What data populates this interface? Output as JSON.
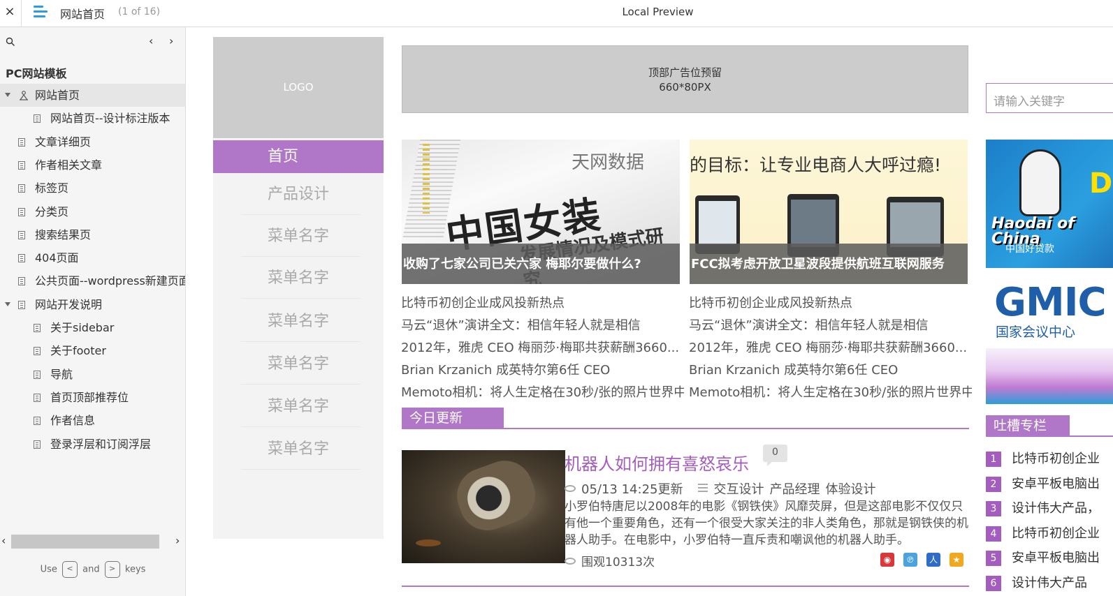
{
  "topbar": {
    "close": "×",
    "page_name": "网站首页",
    "page_count": "(1 of 16)",
    "title": "Local Preview"
  },
  "sidebar": {
    "prev": "‹",
    "next": "›",
    "project": "PC网站模板",
    "items": [
      {
        "label": "网站首页",
        "level": 0,
        "caret": true,
        "icon": "home-icon",
        "active": true
      },
      {
        "label": "网站首页--设计标注版本",
        "level": 1
      },
      {
        "label": "文章详细页",
        "level": 0
      },
      {
        "label": "作者相关文章",
        "level": 0
      },
      {
        "label": "标签页",
        "level": 0
      },
      {
        "label": "分类页",
        "level": 0
      },
      {
        "label": "搜索结果页",
        "level": 0
      },
      {
        "label": "404页面",
        "level": 0
      },
      {
        "label": "公共页面--wordpress新建页面",
        "level": 0
      },
      {
        "label": "网站开发说明",
        "level": 0,
        "caret": true
      },
      {
        "label": "关于sidebar",
        "level": 1
      },
      {
        "label": "关于footer",
        "level": 1
      },
      {
        "label": "导航",
        "level": 1
      },
      {
        "label": "首页顶部推荐位",
        "level": 1
      },
      {
        "label": "作者信息",
        "level": 1
      },
      {
        "label": "登录浮层和订阅浮层",
        "level": 1
      }
    ],
    "hint_use": "Use",
    "hint_and": "and",
    "hint_keys": "keys",
    "key_prev": "<",
    "key_next": ">"
  },
  "page": {
    "logo": "LOGO",
    "nav": [
      "首页",
      "产品设计",
      "菜单名字",
      "菜单名字",
      "菜单名字",
      "菜单名字",
      "菜单名字",
      "菜单名字"
    ],
    "ad_line1": "顶部广告位预留",
    "ad_line2": "660*80PX",
    "search_placeholder": "请输入关键字",
    "banner1": {
      "caption": "收购了七家公司已关六家 梅耶尔要做什么?",
      "brand": "天网数据",
      "big": "中国女装",
      "sub": "发展情况及模式研究"
    },
    "banner2": {
      "caption": "FCC拟考虑开放卫星波段提供航班互联网服务",
      "headline": "的目标：让专业电商人大呼过瘾!"
    },
    "news": [
      "比特币初创企业成风投新热点",
      "马云“退休”演讲全文：相信年轻人就是相信",
      "2012年，雅虎 CEO 梅丽莎·梅耶共获薪酬3660...",
      "Brian Krzanich 成英特尔第6任 CEO",
      "Memoto相机：将人生定格在30秒/张的照片世界中"
    ],
    "today_tab": "今日更新",
    "article": {
      "title": "机器人如何拥有喜怒哀乐",
      "comments": "0",
      "time": "05/13 14:25更新",
      "tags": [
        "交互设计",
        "产品经理",
        "体验设计"
      ],
      "desc": "小罗伯特唐尼以2008年的电影《钢铁侠》风靡荧屏，但是这部电影不仅仅只有他一个重要角色，还有一个很受大家关注的非人类角色，那就是钢铁侠的机器人助手。在电影中，小罗伯特一直斥责和嘲讽他的机器人助手。",
      "views": "围观10313次"
    },
    "right": {
      "ad1_brand": "Haodai of China",
      "ad1_cn": "中国好贷款",
      "ad2_brand": "GMIC",
      "ad2_sub": "国家会议中心",
      "tucao_tab": "吐槽专栏",
      "rank": [
        {
          "n": "1",
          "text": "比特币初创企业"
        },
        {
          "n": "2",
          "text": "安卓平板电脑出"
        },
        {
          "n": "3",
          "text": "设计伟大产品，"
        },
        {
          "n": "4",
          "text": "比特币初创企业"
        },
        {
          "n": "5",
          "text": "安卓平板电脑出"
        },
        {
          "n": "6",
          "text": "设计伟大产品"
        }
      ]
    }
  },
  "colors": {
    "accent": "#b077c9",
    "link": "#a45dbe",
    "placeholder_gray": "#cccccc",
    "topbar_icon": "#2b9be6"
  }
}
